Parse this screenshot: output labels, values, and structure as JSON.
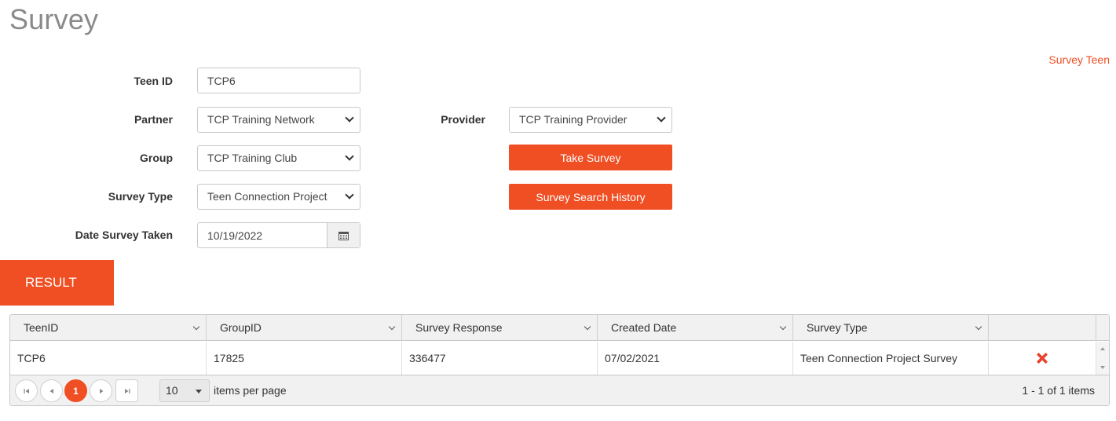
{
  "page": {
    "title": "Survey",
    "top_link": "Survey Teen"
  },
  "form": {
    "teen_id": {
      "label": "Teen ID",
      "value": "TCP6"
    },
    "partner": {
      "label": "Partner",
      "value": "TCP Training Network"
    },
    "provider": {
      "label": "Provider",
      "value": "TCP Training Provider"
    },
    "group": {
      "label": "Group",
      "value": "TCP Training Club"
    },
    "survey_type": {
      "label": "Survey Type",
      "value": "Teen Connection Project"
    },
    "date_taken": {
      "label": "Date Survey Taken",
      "value": "10/19/2022",
      "icon": "calendar-icon"
    }
  },
  "actions": {
    "take_survey": "Take Survey",
    "search_history": "Survey Search History"
  },
  "result": {
    "tab_label": "RESULT",
    "columns": [
      "TeenID",
      "GroupID",
      "Survey Response",
      "Created Date",
      "Survey Type",
      ""
    ],
    "rows": [
      {
        "teen_id": "TCP6",
        "group_id": "17825",
        "survey_response": "336477",
        "created_date": "07/02/2021",
        "survey_type": "Teen Connection Project Survey",
        "action_icon": "delete-icon"
      }
    ]
  },
  "pager": {
    "current_page": "1",
    "page_size": "10",
    "items_per_page_label": "items per page",
    "info": "1 - 1 of 1 items"
  },
  "colors": {
    "accent": "#f04e23",
    "title_gray": "#8a8a8a",
    "delete_red": "#e8402a"
  }
}
